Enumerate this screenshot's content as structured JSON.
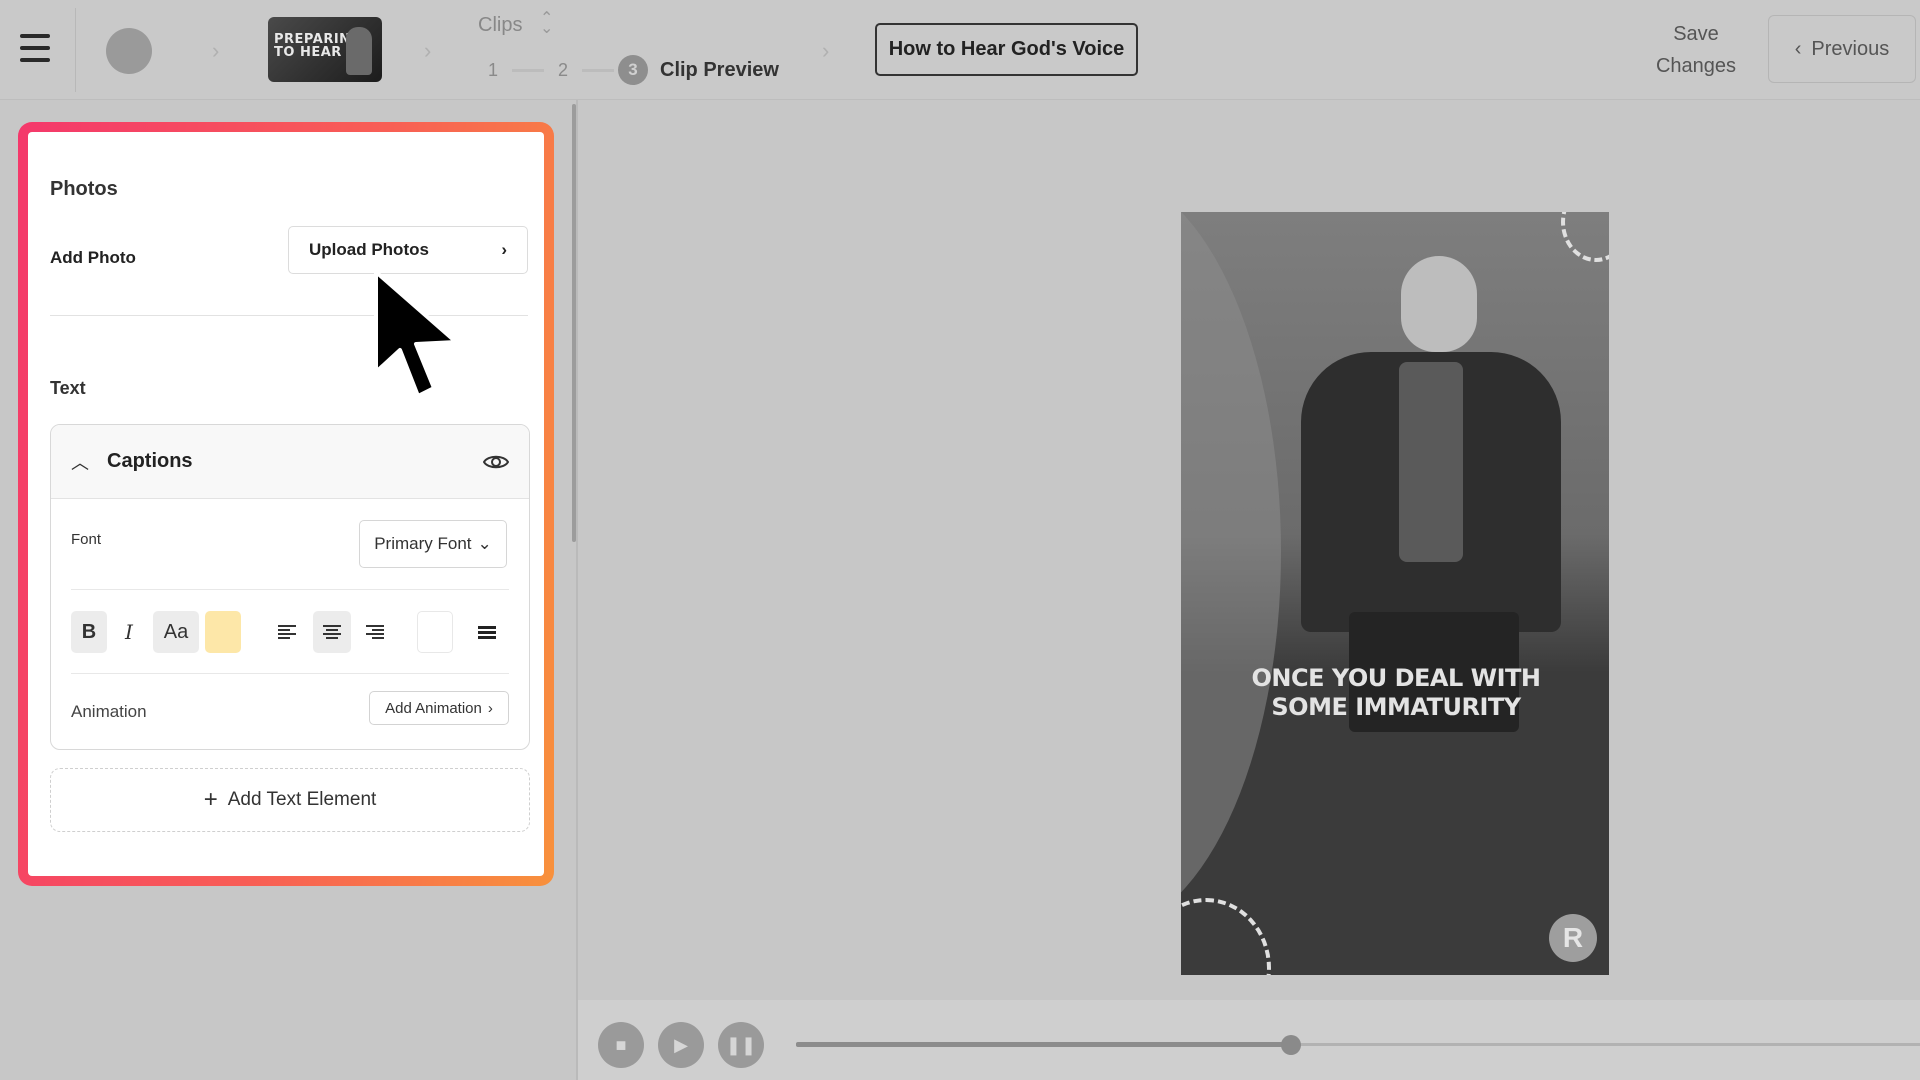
{
  "header": {
    "thumbnail_text": "PREPARING TO HEAR",
    "clips_label": "Clips",
    "steps": [
      "1",
      "2",
      "3"
    ],
    "active_step_label": "Clip Preview",
    "clip_title": "How to Hear God's Voice",
    "save_label": "Save Changes",
    "previous_label": "Previous"
  },
  "panel": {
    "photos_title": "Photos",
    "add_photo_label": "Add Photo",
    "upload_label": "Upload Photos",
    "text_title": "Text",
    "captions": {
      "title": "Captions",
      "font_label": "Font",
      "font_value": "Primary Font",
      "bold": "B",
      "italic": "I",
      "case": "Aa",
      "highlight_color": "#fde7a8",
      "text_color": "#ffffff",
      "animation_label": "Animation",
      "add_animation_label": "Add Animation"
    },
    "add_text_element_label": "Add Text Element"
  },
  "preview": {
    "caption": "ONCE YOU DEAL WITH SOME IMMATURITY",
    "logo_letter": "R"
  },
  "player": {
    "progress": 0.44
  },
  "colors": {
    "panel_gradient_start": "#f4386b",
    "panel_gradient_end": "#f8913c"
  }
}
